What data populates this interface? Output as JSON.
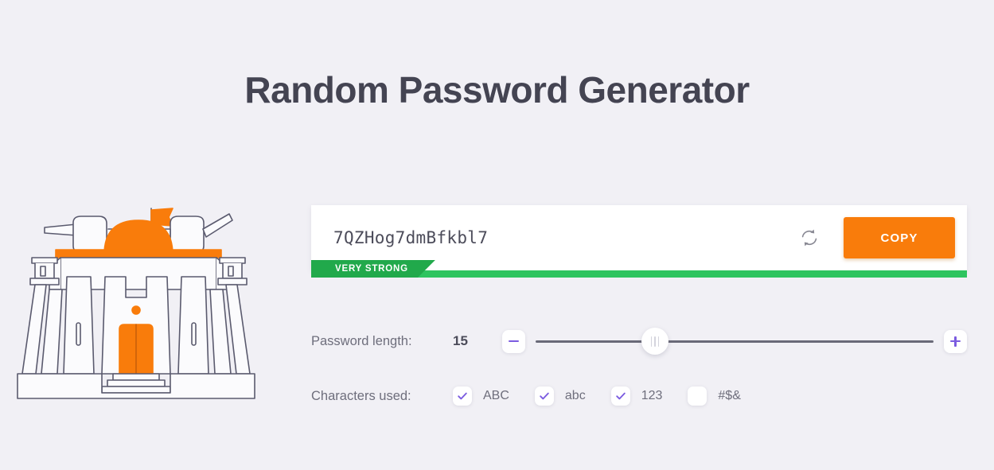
{
  "page": {
    "title": "Random Password Generator",
    "background_color": "#f1f0f5"
  },
  "illustration": {
    "name": "fortress-bunker-illustration",
    "accent_color": "#f97c0b",
    "line_color": "#5a5a6e"
  },
  "generator": {
    "password": "7QZHog7dmBfkbl7",
    "refresh_icon": "refresh-icon",
    "copy_label": "COPY",
    "copy_color": "#f97c0b",
    "strength": {
      "label": "VERY STRONG",
      "bar_color": "#2ec45f",
      "badge_color": "#21a94b",
      "percent": 100
    }
  },
  "length": {
    "label": "Password length:",
    "value": "15",
    "min": 4,
    "max": 32,
    "decrement_icon": "minus-icon",
    "increment_icon": "plus-icon",
    "slider_percent": 30,
    "accent_color": "#7b5ce0"
  },
  "characters": {
    "label": "Characters used:",
    "options": [
      {
        "id": "uppercase",
        "label": "ABC",
        "checked": true
      },
      {
        "id": "lowercase",
        "label": "abc",
        "checked": true
      },
      {
        "id": "numbers",
        "label": "123",
        "checked": true
      },
      {
        "id": "symbols",
        "label": "#$&",
        "checked": false
      }
    ]
  }
}
